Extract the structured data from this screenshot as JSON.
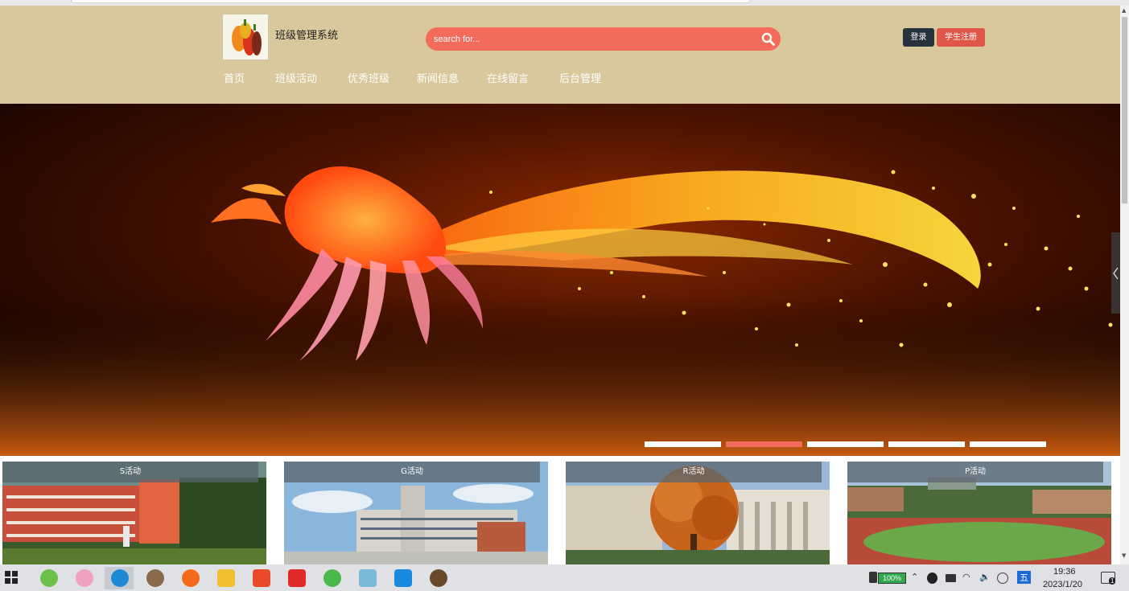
{
  "header": {
    "site_title": "班级管理系统",
    "search_placeholder": "search for...",
    "login_label": "登录",
    "register_label": "学生注册",
    "nav": [
      "首页",
      "班级活动",
      "优秀班级",
      "新闻信息",
      "在线留言",
      "后台管理"
    ]
  },
  "banner": {
    "active_slide_index": 1
  },
  "cards": [
    {
      "label": "S活动"
    },
    {
      "label": "G活动"
    },
    {
      "label": "R活动"
    },
    {
      "label": "P活动"
    }
  ],
  "taskbar": {
    "battery": "100%",
    "time": "19:36",
    "date": "2023/1/20",
    "ime": "五",
    "notification_count": "1"
  },
  "colors": {
    "header_bg": "#d8c89c",
    "accent": "#f26b5b",
    "login_bg": "#26333f"
  }
}
